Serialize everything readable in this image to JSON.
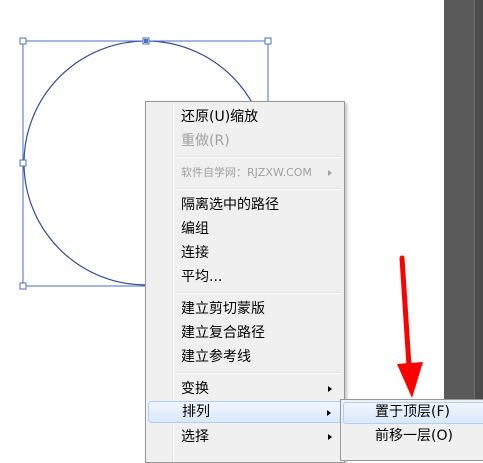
{
  "context_menu": {
    "items": [
      {
        "label": "还原(U)缩放"
      },
      {
        "label": "重做(R)"
      },
      {
        "label": "软件自学网：RJZXW.COM"
      },
      {
        "label": "隔离选中的路径"
      },
      {
        "label": "编组"
      },
      {
        "label": "连接"
      },
      {
        "label": "平均..."
      },
      {
        "label": "建立剪切蒙版"
      },
      {
        "label": "建立复合路径"
      },
      {
        "label": "建立参考线"
      },
      {
        "label": "变换"
      },
      {
        "label": "排列"
      },
      {
        "label": "选择"
      }
    ]
  },
  "submenu": {
    "items": [
      {
        "label": "置于顶层(F)"
      },
      {
        "label": "前移一层(O)"
      }
    ]
  },
  "colors": {
    "selection_blue": "#4a6fc5",
    "arrow_red": "#ff0000",
    "dark_panel": "#5a5a5a"
  }
}
